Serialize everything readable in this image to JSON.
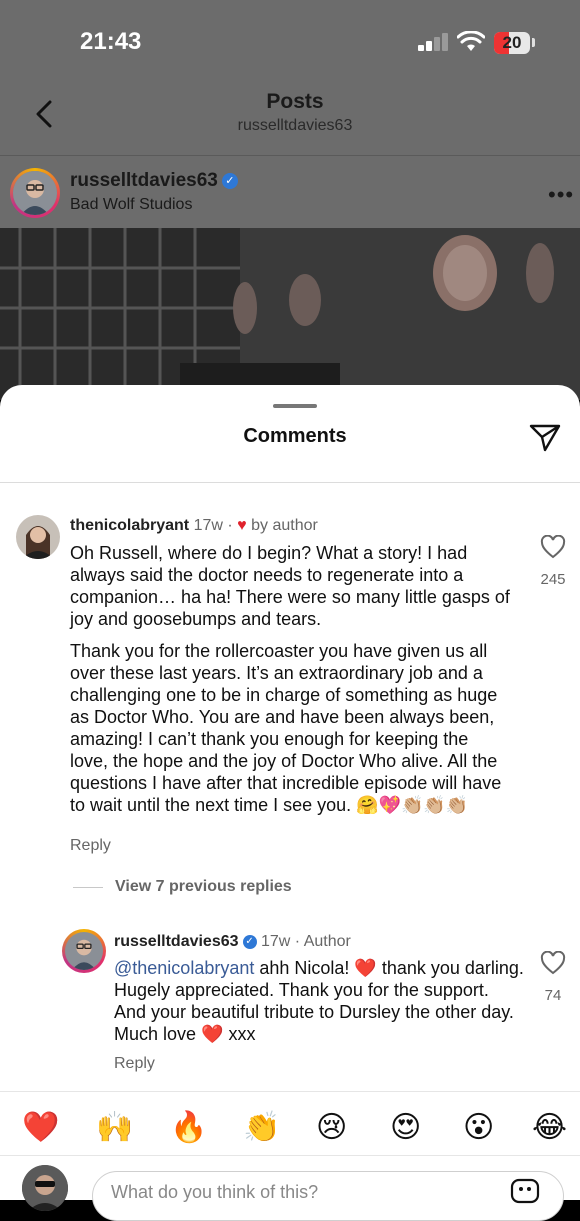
{
  "status_bar": {
    "time": "21:43",
    "battery": "20"
  },
  "post_header": {
    "title": "Posts",
    "subtitle": "russelltdavies63"
  },
  "post": {
    "username": "russelltdavies63",
    "location": "Bad Wolf Studios"
  },
  "comments_sheet": {
    "title": "Comments"
  },
  "comments": [
    {
      "username": "thenicolabryant",
      "time": "17w",
      "liked_by": "by author",
      "paragraphs": [
        "Oh Russell, where do I begin? What a story! I had always said the doctor needs to regenerate into a companion… ha ha! There were so many little gasps of joy and goosebumps and tears.",
        "Thank you for the rollercoaster you have given us all over these last years. It’s an extraordinary job and a challenging one to be in charge of something as huge as Doctor Who. You are and have been always been, amazing! I can’t thank you enough for keeping the love, the hope and the joy of Doctor Who alive. All the questions I have after that incredible episode will have to wait until the next time I see you. 🤗💖👏🏼👏🏼👏🏼"
      ],
      "reply_label": "Reply",
      "like_count": "245"
    }
  ],
  "view_replies": "View 7 previous replies",
  "reply": {
    "username": "russelltdavies63",
    "time": "17w",
    "role": "Author",
    "mention": "@thenicolabryant",
    "text": "ahh Nicola! ❤️ thank you darling. Hugely appreciated. Thank you for the support. And your beautiful tribute to Dursley the other day. Much love ❤️ xxx",
    "reply_label": "Reply",
    "like_count": "74"
  },
  "quick_reactions": [
    "❤️",
    "🙌",
    "🔥",
    "👏",
    "😢",
    "😍",
    "😮",
    "😂"
  ],
  "composer": {
    "placeholder": "What do you think of this?"
  },
  "colors": {
    "heart": "#e0222c",
    "verified": "#2e78d6",
    "mention": "#3a5b96"
  }
}
